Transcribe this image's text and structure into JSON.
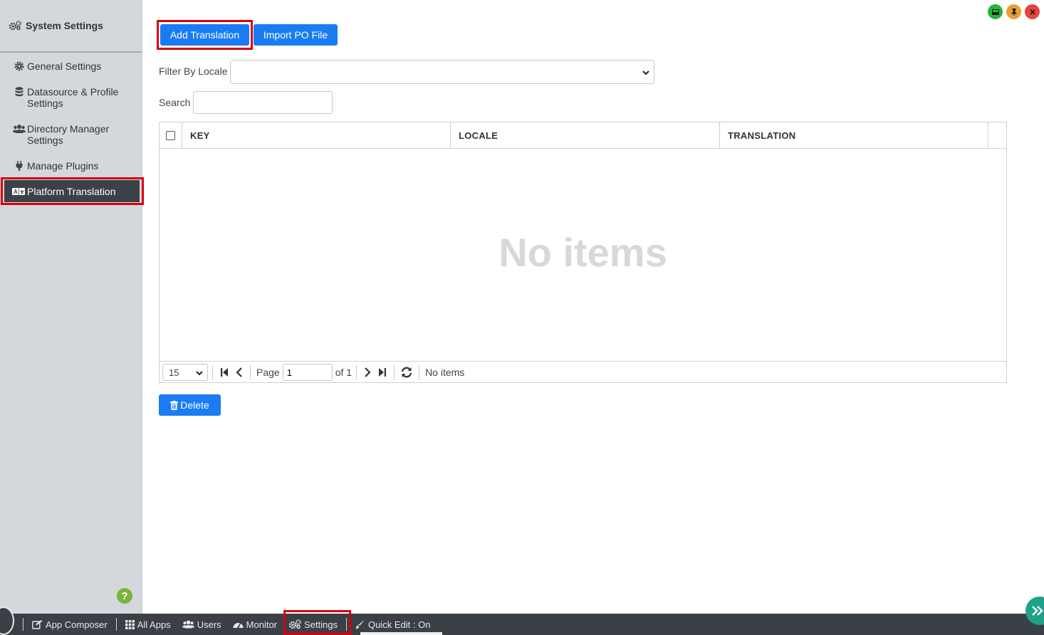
{
  "sidebar": {
    "title": "System Settings",
    "items": [
      {
        "label": "General Settings",
        "icon": "gear-icon"
      },
      {
        "label": "Datasource & Profile Settings",
        "icon": "database-icon"
      },
      {
        "label": "Directory Manager Settings",
        "icon": "users-icon"
      },
      {
        "label": "Manage Plugins",
        "icon": "plug-icon"
      },
      {
        "label": "Platform Translation",
        "icon": "translate-icon",
        "active": true
      }
    ]
  },
  "toolbar": {
    "add_label": "Add Translation",
    "import_label": "Import PO File"
  },
  "filter": {
    "locale_label": "Filter By Locale",
    "locale_value": "",
    "search_label": "Search",
    "search_value": ""
  },
  "table": {
    "columns": [
      "KEY",
      "LOCALE",
      "TRANSLATION"
    ],
    "rows": [],
    "empty_text": "No items"
  },
  "pager": {
    "page_size": "15",
    "page_label": "Page",
    "page_value": "1",
    "of_label": "of 1",
    "status": "No items"
  },
  "actions": {
    "delete_label": "Delete"
  },
  "taskbar": {
    "items": [
      "App Composer",
      "All Apps",
      "Users",
      "Monitor",
      "Settings",
      "Quick Edit : On"
    ]
  },
  "help_label": "?",
  "colors": {
    "primary": "#1a7cf3",
    "highlight": "#d8000c",
    "sidebar_bg": "#d4d8dd",
    "taskbar_bg": "#3a4046"
  }
}
